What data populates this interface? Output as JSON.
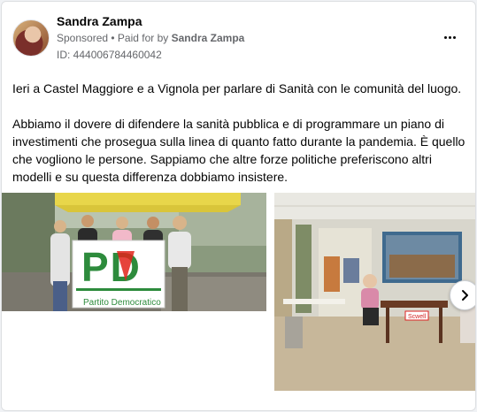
{
  "post": {
    "author_name": "Sandra Zampa",
    "sponsored_label": "Sponsored",
    "separator": " • ",
    "paid_for_label": "Paid for by ",
    "payer_name": "Sandra Zampa",
    "ad_id": "ID: 444006784460042",
    "paragraphs": [
      "Ieri a Castel Maggiore e a Vignola per parlare di Sanità con le comunità del luogo.",
      "Abbiamo il dovere di difendere la sanità pubblica e di programmare un piano di investimenti che prosegua sulla linea di quanto fatto durante la pandemia. È quello che vogliono le persone. Sappiamo che altre forze politiche preferiscono altri modelli e su questa differenza dobbiamo insistere."
    ]
  },
  "photos": {
    "banner_logo_text": "PD",
    "banner_caption": "Partito Democratico",
    "table_sign": "Scwell"
  },
  "icons": {
    "more": "more-horizontal-icon",
    "next": "chevron-right-icon"
  },
  "colors": {
    "pd_green": "#2d8b3c",
    "pd_red": "#e2231a",
    "text_secondary": "#65676b"
  }
}
